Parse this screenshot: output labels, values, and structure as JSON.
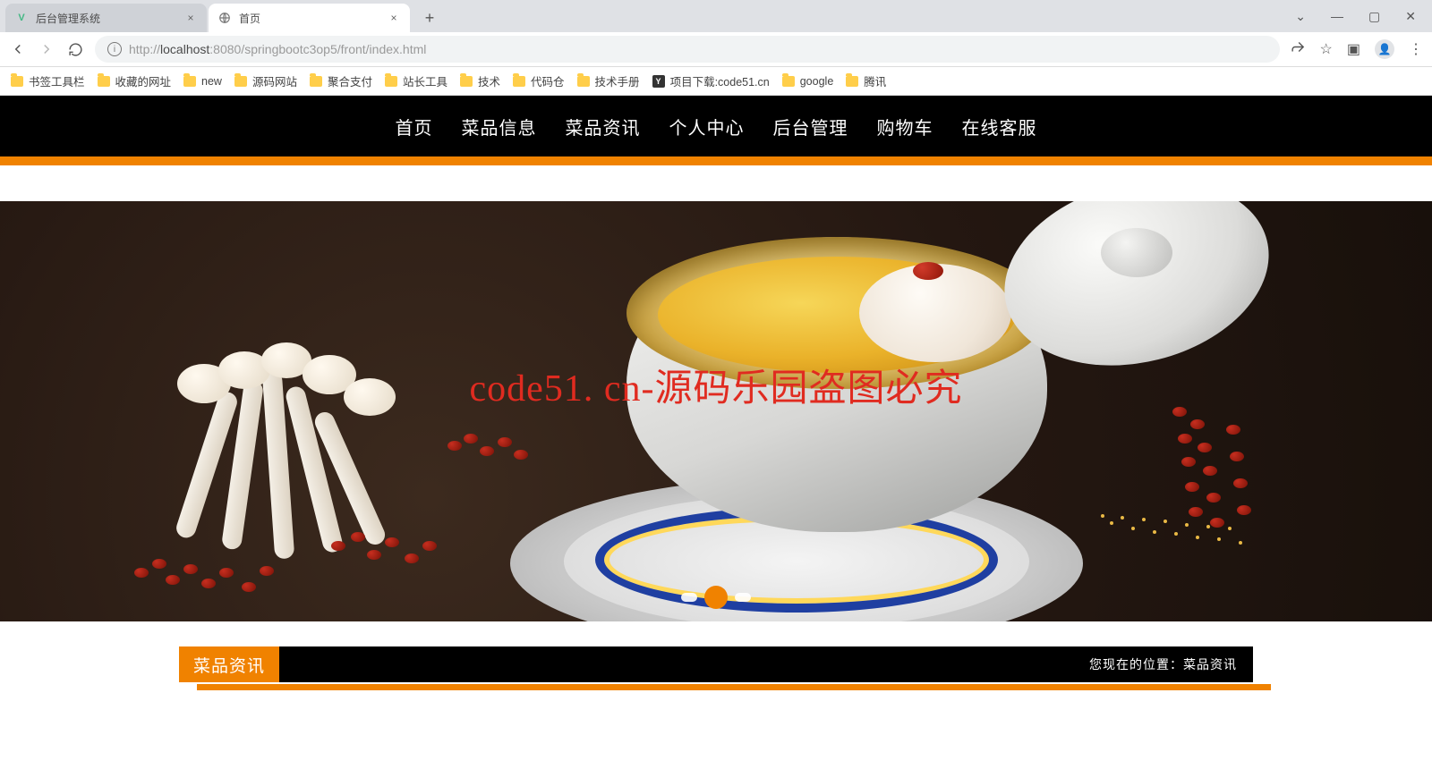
{
  "browser": {
    "tabs": [
      {
        "title": "后台管理系统",
        "active": false,
        "favicon": "V"
      },
      {
        "title": "首页",
        "active": true,
        "favicon": "◌"
      }
    ],
    "url_protocol": "http://",
    "url_host": "localhost",
    "url_port": ":8080",
    "url_path": "/springbootc3op5/front/index.html",
    "bookmarks": [
      {
        "label": "书签工具栏",
        "type": "folder"
      },
      {
        "label": "收藏的网址",
        "type": "folder"
      },
      {
        "label": "new",
        "type": "folder"
      },
      {
        "label": "源码网站",
        "type": "folder"
      },
      {
        "label": "聚合支付",
        "type": "folder"
      },
      {
        "label": "站长工具",
        "type": "folder"
      },
      {
        "label": "技术",
        "type": "folder"
      },
      {
        "label": "代码仓",
        "type": "folder"
      },
      {
        "label": "技术手册",
        "type": "folder"
      },
      {
        "label": "项目下载:code51.cn",
        "type": "ext"
      },
      {
        "label": "google",
        "type": "folder"
      },
      {
        "label": "腾讯",
        "type": "folder"
      }
    ]
  },
  "nav": {
    "items": [
      "首页",
      "菜品信息",
      "菜品资讯",
      "个人中心",
      "后台管理",
      "购物车",
      "在线客服"
    ]
  },
  "hero": {
    "watermark": "code51. cn-源码乐园盗图必究",
    "active_slide": 1,
    "slide_count": 3
  },
  "section": {
    "tag": "菜品资讯",
    "breadcrumb_prefix": "您现在的位置：",
    "breadcrumb_current": "菜品资讯"
  }
}
